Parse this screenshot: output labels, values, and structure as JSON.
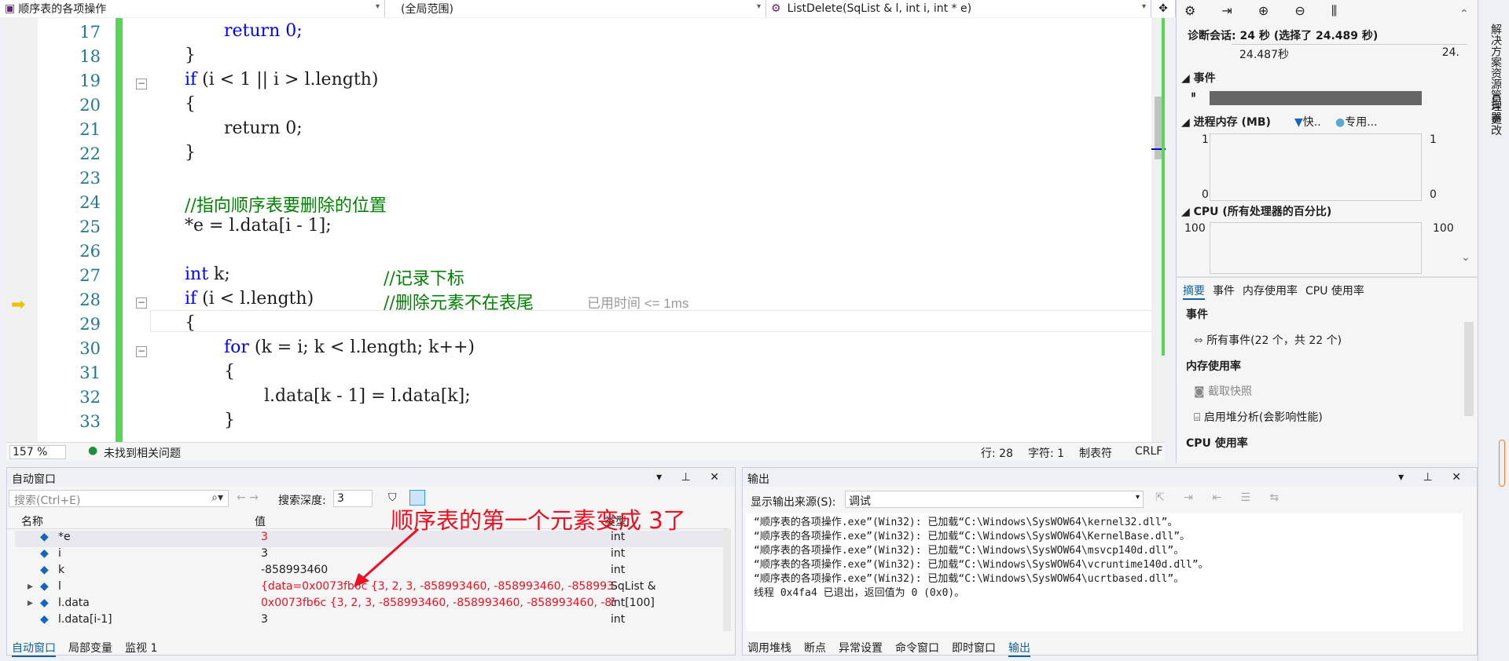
{
  "topbar": {
    "project": "顺序表的各项操作",
    "scope": "(全局范围)",
    "function": "ListDelete(SqList & l, int i, int * e)"
  },
  "code_lines": [
    {
      "n": "17"
    },
    {
      "n": "18"
    },
    {
      "n": "19"
    },
    {
      "n": "20"
    },
    {
      "n": "21"
    },
    {
      "n": "22"
    },
    {
      "n": "23"
    },
    {
      "n": "24"
    },
    {
      "n": "25"
    },
    {
      "n": "26"
    },
    {
      "n": "27"
    },
    {
      "n": "28"
    },
    {
      "n": "29"
    },
    {
      "n": "30"
    },
    {
      "n": "31"
    },
    {
      "n": "32"
    },
    {
      "n": "33"
    }
  ],
  "code": {
    "l17": "return 0;",
    "l18": "}",
    "l19_kw": "if",
    "l19_rest": " (i < 1 || i > l.length)",
    "l20": "{",
    "l21": "return 0;",
    "l22": "}",
    "l24": "//指向顺序表要删除的位置",
    "l25": "*e = l.data[i - 1];",
    "l27_kw": "int",
    "l27_rest": " k;",
    "l27_cm": "//记录下标",
    "l28_kw": "if",
    "l28_rest": " (i < l.length)",
    "l28_cm": "//删除元素不在表尾",
    "l28_hint": "已用时间 <= 1ms",
    "l29": "{",
    "l30_kw": "for",
    "l30_rest": " (k = i; k < l.length; k++)",
    "l31": "{",
    "l32": "l.data[k - 1] = l.data[k];",
    "l33": "}"
  },
  "status": {
    "zoom": "157 %",
    "issues": "未找到相关问题",
    "line": "行: 28",
    "col": "字符: 1",
    "tab": "制表符",
    "eol": "CRLF"
  },
  "auto": {
    "title": "自动窗口",
    "search_placeholder": "搜索(Ctrl+E)",
    "depth_label": "搜索深度:",
    "depth": "3",
    "col_name": "名称",
    "col_value": "值",
    "col_type": "类型",
    "rows": [
      {
        "name": "*e",
        "value": "3",
        "type": "int"
      },
      {
        "name": "i",
        "value": "3",
        "type": "int"
      },
      {
        "name": "k",
        "value": "-858993460",
        "type": "int"
      },
      {
        "name": "l",
        "value": "{data=0x0073fb6c {3, 2, 3, -858993460, -858993460, -858993460, ...",
        "type": "SqList &"
      },
      {
        "name": "l.data",
        "value": "0x0073fb6c {3, 2, 3, -858993460, -858993460, -858993460, -85899...",
        "type": "int[100]"
      },
      {
        "name": "l.data[i-1]",
        "value": "3",
        "type": "int"
      }
    ],
    "tabs": [
      "自动窗口",
      "局部变量",
      "监视 1"
    ]
  },
  "annotation": "顺序表的第一个元素变成 3了",
  "output": {
    "title": "输出",
    "source_label": "显示输出来源(S):",
    "source": "调试",
    "lines": [
      "“顺序表的各项操作.exe”(Win32): 已加载“C:\\Windows\\SysWOW64\\kernel32.dll”。",
      "“顺序表的各项操作.exe”(Win32): 已加载“C:\\Windows\\SysWOW64\\KernelBase.dll”。",
      "“顺序表的各项操作.exe”(Win32): 已加载“C:\\Windows\\SysWOW64\\msvcp140d.dll”。",
      "“顺序表的各项操作.exe”(Win32): 已加载“C:\\Windows\\SysWOW64\\vcruntime140d.dll”。",
      "“顺序表的各项操作.exe”(Win32): 已加载“C:\\Windows\\SysWOW64\\ucrtbased.dll”。",
      "线程 0x4fa4 已退出，返回值为 0 (0x0)。"
    ],
    "tabs": [
      "调用堆栈",
      "断点",
      "异常设置",
      "命令窗口",
      "即时窗口",
      "输出"
    ]
  },
  "diag": {
    "session": "诊断会话: 24 秒 (选择了 24.489 秒)",
    "ruler1": "24.487秒",
    "ruler2": "24.",
    "events": "事件",
    "memory": "进程内存 (MB)",
    "mem_legend1": "快..",
    "mem_legend2": "专用...",
    "mem_top": "1",
    "mem_bottom": "0",
    "cpu": "CPU (所有处理器的百分比)",
    "cpu_top": "100",
    "tabs": [
      "摘要",
      "事件",
      "内存使用率",
      "CPU 使用率"
    ],
    "sec_events": "事件",
    "all_events": "所有事件(22 个，共 22 个)",
    "sec_mem": "内存使用率",
    "snapshot": "截取快照",
    "heap": "启用堆分析(会影响性能)",
    "sec_cpu": "CPU 使用率"
  },
  "side": {
    "solution": "解决方案资源管理器",
    "git": "Git 更改"
  }
}
